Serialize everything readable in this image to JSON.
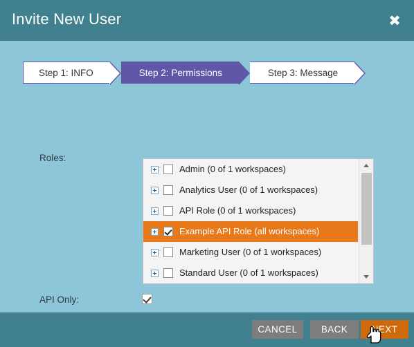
{
  "dialog": {
    "title": "Invite New User",
    "close_icon": "close-x-icon"
  },
  "steps": [
    {
      "label": "Step 1: INFO",
      "active": false
    },
    {
      "label": "Step 2: Permissions",
      "active": true
    },
    {
      "label": "Step 3: Message",
      "active": false
    }
  ],
  "form": {
    "roles_label": "Roles:",
    "api_only_label": "API Only:",
    "api_only_checked": true
  },
  "roles": [
    {
      "label": "Admin (0 of 1 workspaces)",
      "checked": false,
      "selected": false
    },
    {
      "label": "Analytics User (0 of 1 workspaces)",
      "checked": false,
      "selected": false
    },
    {
      "label": "API Role (0 of 1 workspaces)",
      "checked": false,
      "selected": false
    },
    {
      "label": "Example API Role (all workspaces)",
      "checked": true,
      "selected": true
    },
    {
      "label": "Marketing User (0 of 1 workspaces)",
      "checked": false,
      "selected": false
    },
    {
      "label": "Standard User (0 of 1 workspaces)",
      "checked": false,
      "selected": false
    }
  ],
  "scrollbar": {
    "up_icon": "triangle-up-icon",
    "down_icon": "triangle-down-icon"
  },
  "footer": {
    "cancel_label": "CANCEL",
    "back_label": "BACK",
    "next_label": "NEXT"
  },
  "colors": {
    "header_bg": "#41808f",
    "body_bg": "#8ec6d9",
    "step_active": "#6157a8",
    "row_selected": "#e8791a",
    "next_button": "#cf6a0c",
    "gray_button": "#7d7d7d"
  },
  "cursor": "pointer-hand-cursor"
}
